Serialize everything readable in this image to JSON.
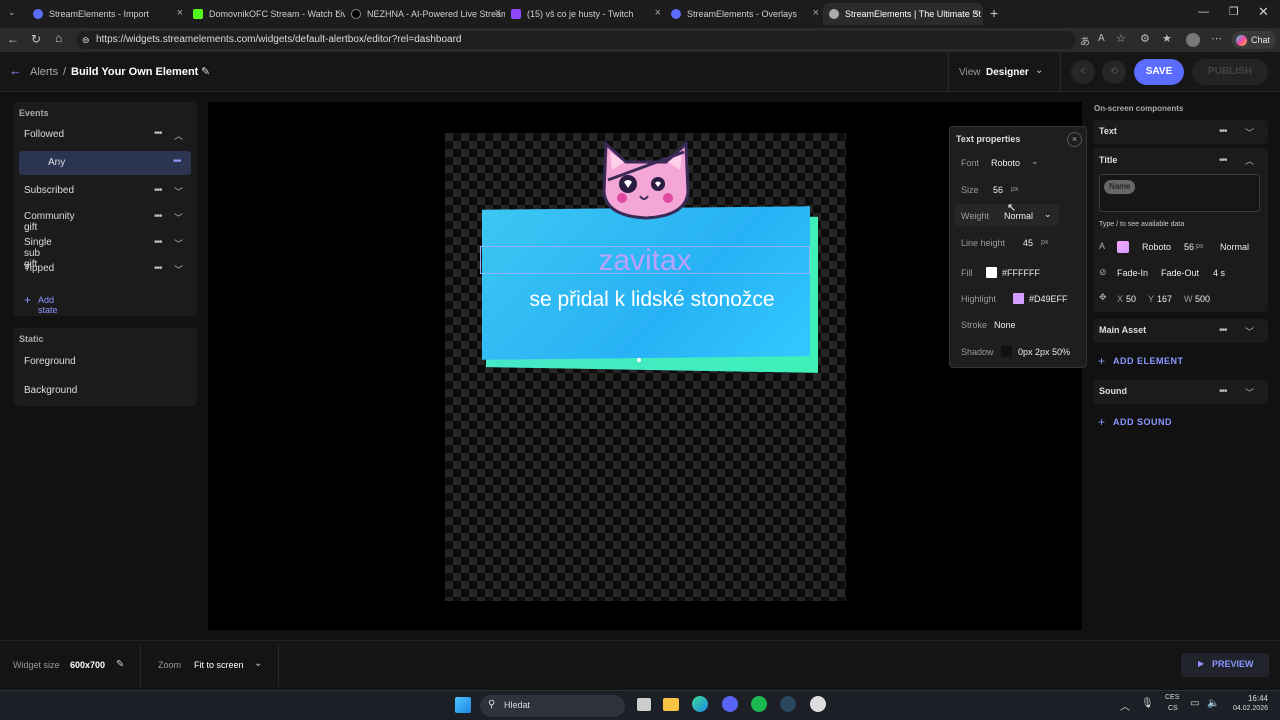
{
  "browser": {
    "tabs": [
      "StreamElements - Import",
      "DomovnikOFC Stream - Watch Liv",
      "NEZHNA - AI-Powered Live Stream",
      "(15) vš co je husty - Twitch",
      "StreamElements - Overlays",
      "StreamElements | The Ultimate St"
    ],
    "url": "https://widgets.streamelements.com/widgets/default-alertbox/editor?rel=dashboard",
    "chat_label": "Chat"
  },
  "header": {
    "crumb": "Alerts",
    "sep": "/",
    "title": "Build Your Own Element",
    "view_label": "View",
    "view_value": "Designer",
    "save": "SAVE",
    "publish": "PUBLISH"
  },
  "events": {
    "heading": "Events",
    "items": [
      "Followed",
      "Any",
      "Subscribed",
      "Community gift",
      "Single sub gift",
      "Tipped"
    ],
    "add_state": "Add state"
  },
  "static": {
    "heading": "Static",
    "items": [
      "Foreground",
      "Background"
    ]
  },
  "alert": {
    "name": "zavitax",
    "message": "se přidal k lidské stonožce"
  },
  "text_props": {
    "title": "Text properties",
    "font_label": "Font",
    "font": "Roboto",
    "size_label": "Size",
    "size": "56",
    "px": "px",
    "weight_label": "Weight",
    "weight": "Normal",
    "lh_label": "Line height",
    "lh": "45",
    "fill_label": "Fill",
    "fill": "#FFFFFF",
    "hl_label": "Highlight",
    "hl": "#D49EFF",
    "stroke_label": "Stroke",
    "stroke": "None",
    "shadow_label": "Shadow",
    "shadow": "0px 2px 50%"
  },
  "components": {
    "heading": "On-screen components",
    "text": "Text",
    "title": "Title",
    "chip": "Name",
    "hint": "Type / to see available data",
    "font": "Roboto",
    "size": "56",
    "px": "px",
    "weight": "Normal",
    "fade_in": "Fade-In",
    "fade_out": "Fade-Out",
    "dur": "4 s",
    "x_label": "X",
    "x": "50",
    "y_label": "Y",
    "y": "167",
    "w_label": "W",
    "w": "500",
    "main_asset": "Main Asset",
    "add_element": "ADD ELEMENT",
    "sound": "Sound",
    "add_sound": "ADD SOUND"
  },
  "footer": {
    "widget_size_label": "Widget size",
    "widget_size": "600x700",
    "zoom_label": "Zoom",
    "zoom": "Fit to screen",
    "preview": "PREVIEW"
  },
  "taskbar": {
    "search": "Hledat",
    "lang1": "CES",
    "lang2": "CS",
    "time": "16:44",
    "date": "04.02.2026"
  },
  "colors": {
    "accent": "#5b6cff",
    "highlight": "#D49EFF",
    "fill": "#FFFFFF"
  }
}
